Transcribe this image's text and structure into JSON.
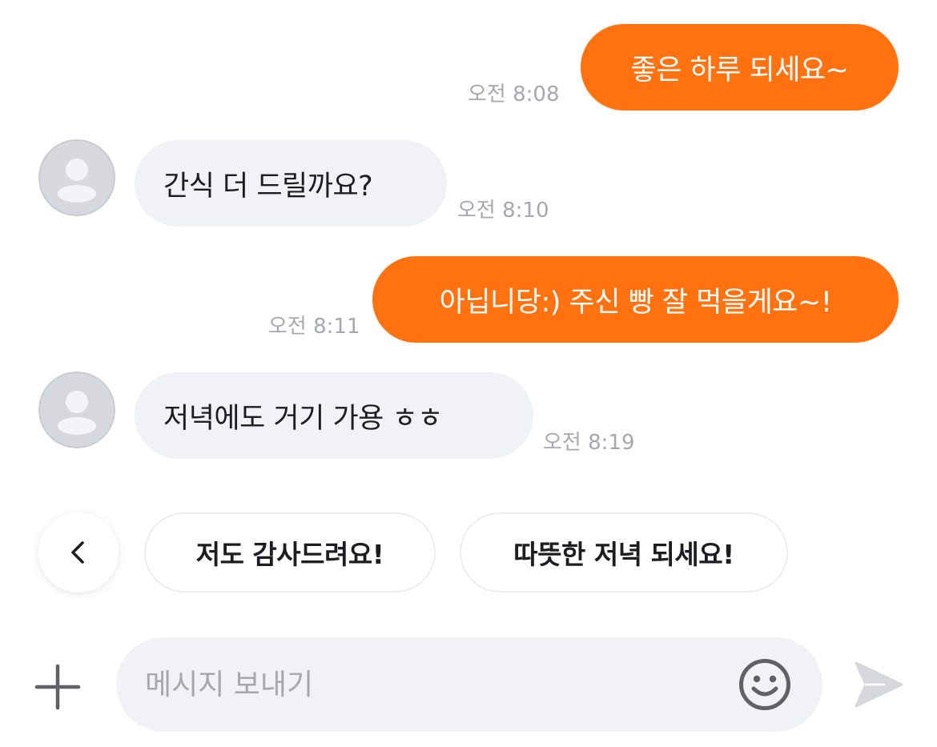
{
  "messages": [
    {
      "direction": "outgoing",
      "text": "좋은 하루 되세요~",
      "time": "오전 8:08"
    },
    {
      "direction": "incoming",
      "text": "간식 더 드릴까요?",
      "time": "오전 8:10"
    },
    {
      "direction": "outgoing",
      "text": "아닙니당:) 주신 빵 잘 먹을게요~!",
      "time": "오전 8:11"
    },
    {
      "direction": "incoming",
      "text": "저녁에도 거기 가용 ㅎㅎ",
      "time": "오전 8:19"
    }
  ],
  "quick_replies": {
    "items": [
      "저도 감사드려요!",
      "따뜻한 저녁 되세요!"
    ]
  },
  "composer": {
    "placeholder": "메시지 보내기",
    "value": ""
  },
  "colors": {
    "outgoing_bubble": "#ff720f",
    "incoming_bubble": "#f1f2f6",
    "timestamp": "#a5a8b0",
    "input_background": "#f1f2f6"
  },
  "icons": {
    "back": "chevron-left-icon",
    "attach": "plus-icon",
    "emoji": "smiley-icon",
    "send": "paper-plane-icon",
    "avatar": "default-user-icon"
  }
}
